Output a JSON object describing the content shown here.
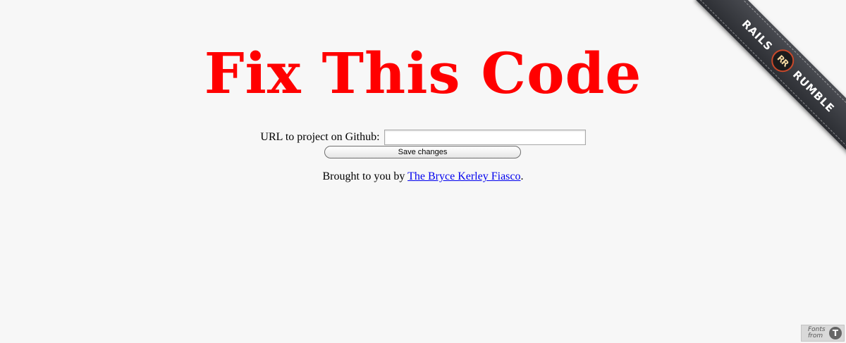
{
  "header": {
    "title": "Fix This Code"
  },
  "form": {
    "url_label": "URL to project on Github:",
    "url_value": "",
    "url_placeholder": "",
    "submit_label": "Save changes"
  },
  "credit": {
    "prefix": "Brought to you by ",
    "link_text": "The Bryce Kerley Fiasco",
    "suffix": "."
  },
  "banner": {
    "left_text": "RAILS",
    "logo_text": "RR",
    "right_text": "RUMBLE"
  },
  "fonts_badge": {
    "line1": "Fonts",
    "line2": "from",
    "icon_text": "T"
  },
  "colors": {
    "title": "#ff0000",
    "link": "#0000ee",
    "background": "#f7f7f7",
    "banner": "#2f3136"
  }
}
